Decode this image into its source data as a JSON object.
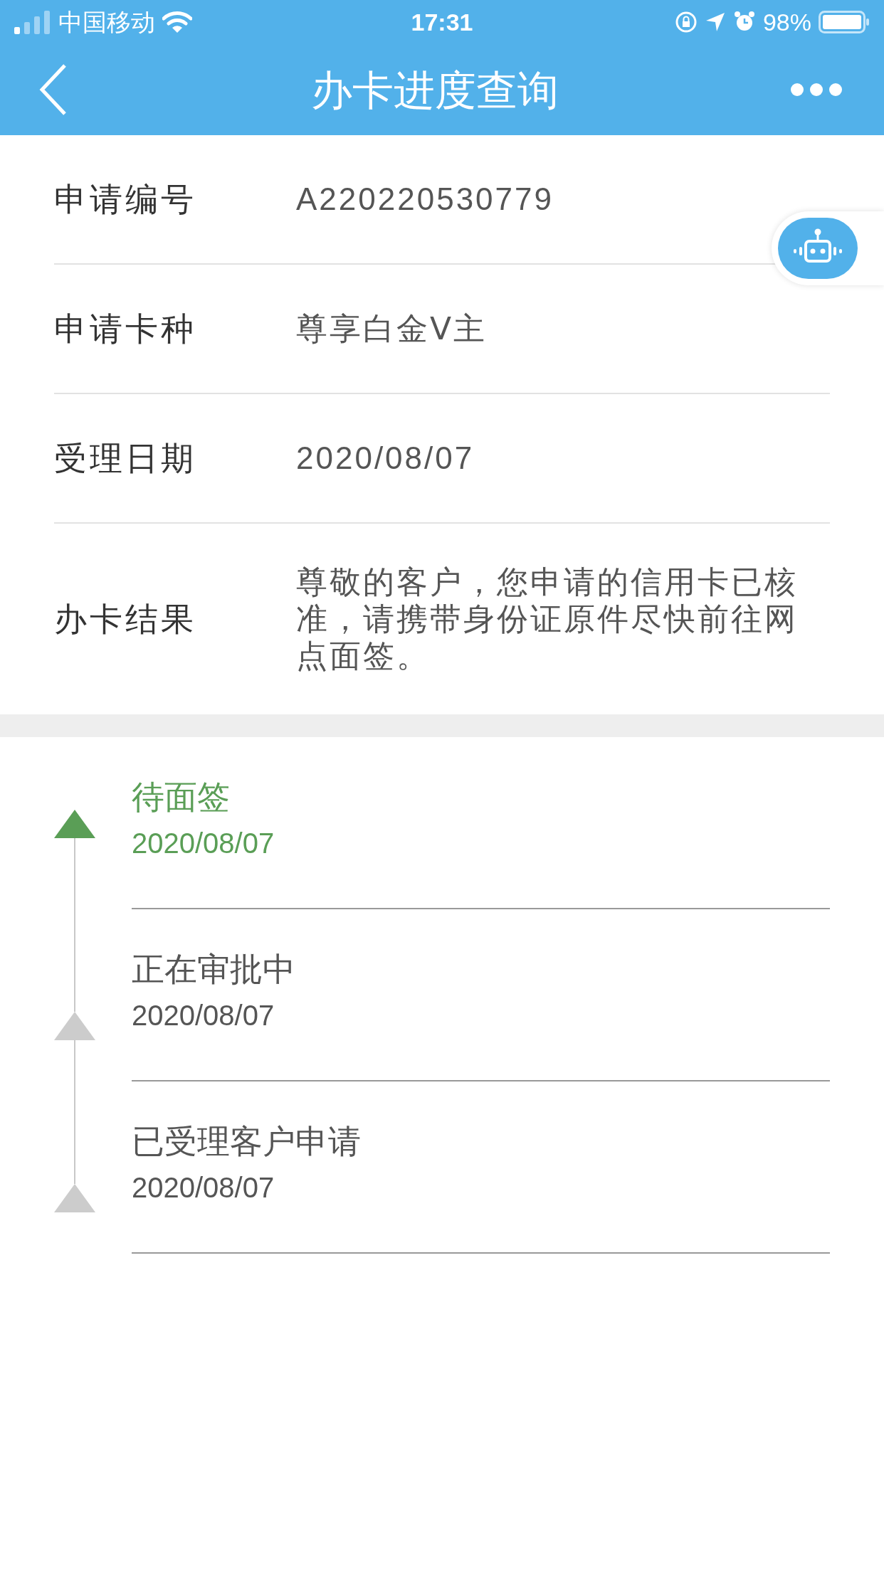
{
  "status_bar": {
    "carrier": "中国移动",
    "time": "17:31",
    "battery": "98%"
  },
  "nav": {
    "title": "办卡进度查询"
  },
  "details": [
    {
      "label": "申请编号",
      "value": "A220220530779"
    },
    {
      "label": "申请卡种",
      "value": "尊享白金Ⅴ主"
    },
    {
      "label": "受理日期",
      "value": "2020/08/07"
    },
    {
      "label": "办卡结果",
      "value": "尊敬的客户，您申请的信用卡已核准，请携带身份证原件尽快前往网点面签。"
    }
  ],
  "timeline": [
    {
      "title": "待面签",
      "date": "2020/08/07",
      "current": true
    },
    {
      "title": "正在审批中",
      "date": "2020/08/07",
      "current": false
    },
    {
      "title": "已受理客户申请",
      "date": "2020/08/07",
      "current": false
    }
  ]
}
